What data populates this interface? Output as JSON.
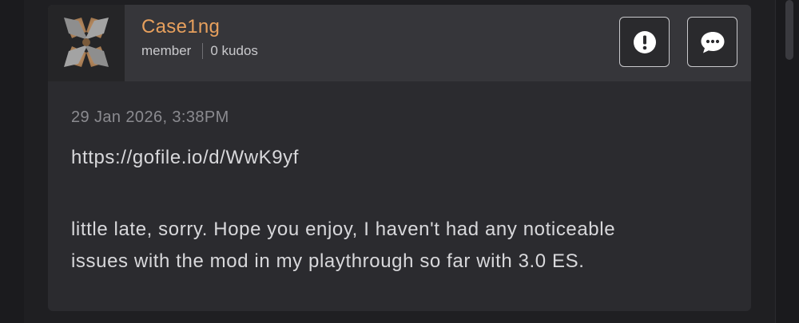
{
  "post": {
    "author": {
      "username": "Case1ng",
      "role": "member",
      "kudos": "0 kudos",
      "avatar_icon": "x-logo-avatar"
    },
    "actions": {
      "report_icon": "exclamation-icon",
      "reply_icon": "chat-bubble-icon"
    },
    "timestamp": "29 Jan 2026, 3:38PM",
    "link": "https://gofile.io/d/WwK9yf",
    "message_lines": [
      "little late, sorry. Hope you enjoy, I haven't had any noticeable",
      "issues with the mod in my playthrough so far with 3.0 ES."
    ]
  },
  "colors": {
    "username": "#e7a05d",
    "card": "#2b2b2f",
    "header": "#36363a",
    "text": "#d8d8db",
    "muted": "#8b8b90"
  }
}
